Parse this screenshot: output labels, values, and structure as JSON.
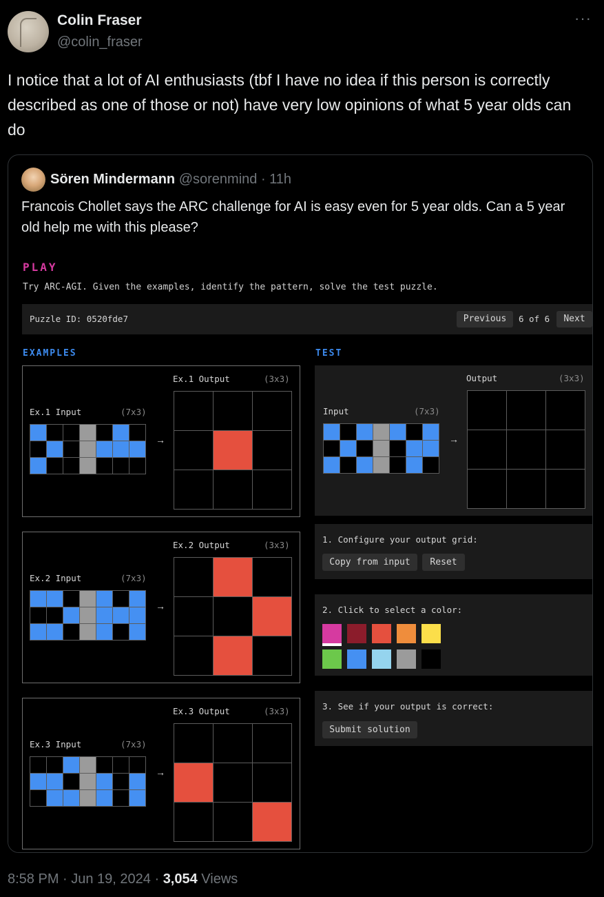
{
  "tweet": {
    "author_name": "Colin Fraser",
    "author_handle": "@colin_fraser",
    "more_label": "···",
    "text": "I notice that a lot of AI enthusiasts (tbf I have no idea if this person is correctly described as one of those or not) have very low opinions of what 5 year olds can do",
    "timestamp": "8:58 PM · Jun 19, 2024 · ",
    "views_count": "3,054",
    "views_label": " Views"
  },
  "quoted": {
    "author_name": "Sören Mindermann",
    "author_handle": "@sorenmind",
    "time": " · 11h",
    "text": "Francois Chollet says the ARC challenge for AI is easy even for 5 year olds. Can a 5 year old help me with this please?"
  },
  "arc": {
    "title": "PLAY",
    "intro": "Try ARC-AGI. Given the examples, identify the pattern, solve the test puzzle.",
    "puzzle_id": "Puzzle ID: 0520fde7",
    "previous_label": "Previous",
    "page_indicator": "6 of 6",
    "next_label": "Next",
    "examples_label": "EXAMPLES",
    "test_label": "TEST",
    "arrow": "→",
    "examples": [
      {
        "input_label": "Ex.1 Input",
        "input_dim": "(7x3)",
        "output_label": "Ex.1 Output",
        "output_dim": "(3x3)",
        "input": [
          "bccgcbc",
          "cbcgbbb",
          "bccgccc"
        ],
        "output": [
          "ccc",
          "crc",
          "ccc"
        ]
      },
      {
        "input_label": "Ex.2 Input",
        "input_dim": "(7x3)",
        "output_label": "Ex.2 Output",
        "output_dim": "(3x3)",
        "input": [
          "bbcgbcb",
          "ccbgbbb",
          "bbcgbcb"
        ],
        "output": [
          "crc",
          "ccr",
          "crc"
        ]
      },
      {
        "input_label": "Ex.3 Input",
        "input_dim": "(7x3)",
        "output_label": "Ex.3 Output",
        "output_dim": "(3x3)",
        "input": [
          "ccbgccc",
          "bbcgbcb",
          "cbbgbcb"
        ],
        "output": [
          "ccc",
          "rcc",
          "ccr"
        ]
      }
    ],
    "test": {
      "input_label": "Input",
      "input_dim": "(7x3)",
      "output_label": "Output",
      "output_dim": "(3x3)",
      "input": [
        "bcbgbcb",
        "cbcgcbb",
        "bcbgcbc"
      ],
      "output": [
        "ccc",
        "ccc",
        "ccc"
      ]
    },
    "step1_label": "1. Configure your output grid:",
    "copy_label": "Copy from input",
    "reset_label": "Reset",
    "step2_label": "2. Click to select a color:",
    "palette": [
      "#d63aa0",
      "#8b1c2b",
      "#e5503e",
      "#ef8d3c",
      "#fbde4a",
      "#6cc84b",
      "#4590f2",
      "#95d4ee",
      "#9b9b9b",
      "#000000"
    ],
    "step3_label": "3. See if your output is correct:",
    "submit_label": "Submit solution"
  }
}
